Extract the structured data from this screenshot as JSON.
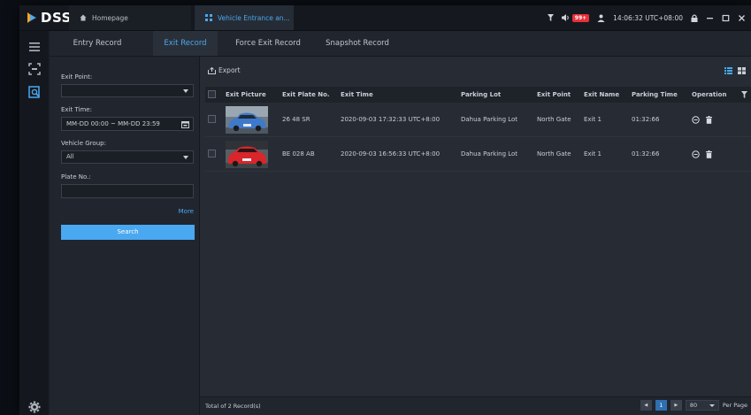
{
  "app": {
    "name": "DSS"
  },
  "tabs": [
    {
      "label": "Homepage",
      "icon": "home-icon"
    },
    {
      "label": "Vehicle Entrance an...",
      "icon": "grid-icon"
    }
  ],
  "tray": {
    "badge": "99+",
    "time": "14:06:32 UTC+08:00"
  },
  "subtabs": [
    "Entry Record",
    "Exit Record",
    "Force Exit Record",
    "Snapshot Record"
  ],
  "filter": {
    "exit_point_label": "Exit Point:",
    "exit_point_value": "",
    "exit_time_label": "Exit Time:",
    "exit_time_value": "MM-DD 00:00 ~ MM-DD 23:59",
    "vehicle_group_label": "Vehicle Group:",
    "vehicle_group_value": "All",
    "plate_label": "Plate No.:",
    "plate_value": "",
    "more": "More",
    "search": "Search"
  },
  "toolbar": {
    "export": "Export"
  },
  "table": {
    "columns": [
      "Exit Picture",
      "Exit Plate No.",
      "Exit Time",
      "Parking Lot",
      "Exit Point",
      "Exit Name",
      "Parking Time",
      "Operation"
    ],
    "rows": [
      {
        "plate": "26 48 SR",
        "time": "2020-09-03 17:32:33 UTC+8:00",
        "lot": "Dahua Parking Lot",
        "point": "North Gate",
        "name": "Exit 1",
        "duration": "01:32:66",
        "car_color": "#3f79c9"
      },
      {
        "plate": "BE 028 AB",
        "time": "2020-09-03 16:56:33 UTC+8:00",
        "lot": "Dahua Parking Lot",
        "point": "North Gate",
        "name": "Exit 1",
        "duration": "01:32:66",
        "car_color": "#d8262b"
      }
    ]
  },
  "footer": {
    "total": "Total of 2 Record(s)",
    "page": "1",
    "page_size": "80",
    "per_page": "Per Page"
  },
  "colors": {
    "accent": "#4aa8f0",
    "badge": "#e6313a"
  }
}
